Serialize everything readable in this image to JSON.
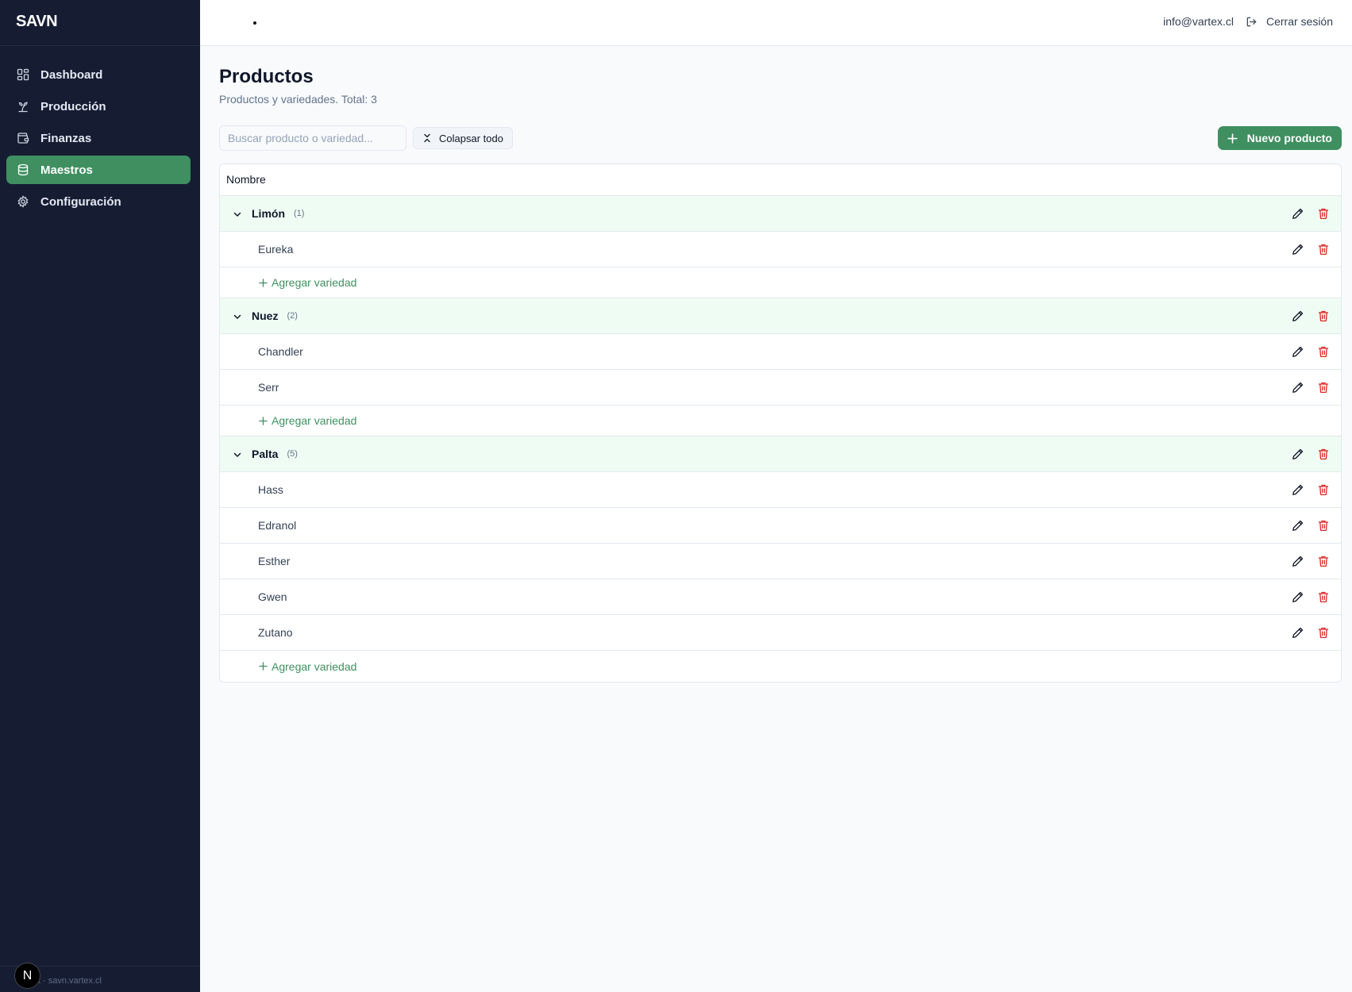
{
  "app": {
    "brand": "SAVN",
    "footer_text": "Vartex · savn.vartex.cl",
    "footer_badge": "N"
  },
  "sidebar": {
    "items": [
      {
        "label": "Dashboard",
        "icon": "dashboard-icon",
        "active": false
      },
      {
        "label": "Producción",
        "icon": "sprout-icon",
        "active": false
      },
      {
        "label": "Finanzas",
        "icon": "wallet-icon",
        "active": false
      },
      {
        "label": "Maestros",
        "icon": "database-icon",
        "active": true
      },
      {
        "label": "Configuración",
        "icon": "gear-icon",
        "active": false
      }
    ]
  },
  "topbar": {
    "email": "info@vartex.cl",
    "logout_label": "Cerrar sesión"
  },
  "page": {
    "title": "Productos",
    "subtitle": "Productos y variedades. Total: 3"
  },
  "toolbar": {
    "search_placeholder": "Buscar producto o variedad...",
    "collapse_label": "Colapsar todo",
    "new_label": "Nuevo producto"
  },
  "table": {
    "header": "Nombre",
    "add_variety_label": "Agregar variedad",
    "groups": [
      {
        "name": "Limón",
        "count": "(1)",
        "varieties": [
          "Eureka"
        ]
      },
      {
        "name": "Nuez",
        "count": "(2)",
        "varieties": [
          "Chandler",
          "Serr"
        ]
      },
      {
        "name": "Palta",
        "count": "(5)",
        "varieties": [
          "Hass",
          "Edranol",
          "Esther",
          "Gwen",
          "Zutano"
        ]
      }
    ]
  },
  "colors": {
    "sidebar_bg": "#161d33",
    "accent": "#3f8f60",
    "group_row_bg": "#effcf3",
    "delete": "#dc2626"
  }
}
